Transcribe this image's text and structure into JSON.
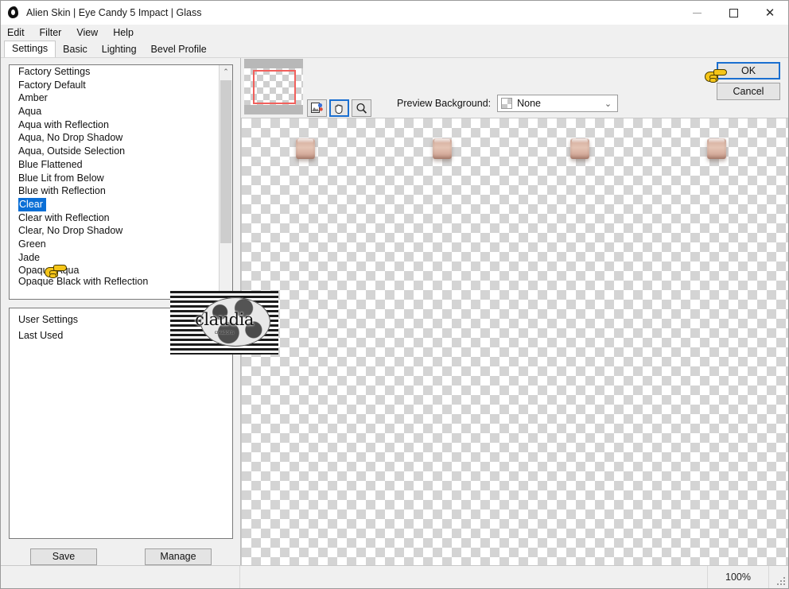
{
  "window": {
    "title": "Alien Skin | Eye Candy 5 Impact | Glass",
    "app_icon": "alien-head-icon",
    "controls": {
      "minimize": "–",
      "maximize": "▢",
      "close": "✕"
    }
  },
  "menubar": {
    "items": [
      "Edit",
      "Filter",
      "View",
      "Help"
    ]
  },
  "tabs": {
    "items": [
      "Settings",
      "Basic",
      "Lighting",
      "Bevel Profile"
    ],
    "active": "Settings"
  },
  "presets": {
    "items": [
      "Factory Settings",
      "Factory Default",
      "Amber",
      "Aqua",
      "Aqua with Reflection",
      "Aqua, No Drop Shadow",
      "Aqua, Outside Selection",
      "Blue Flattened",
      "Blue Lit from Below",
      "Blue with Reflection",
      "Clear",
      "Clear with Reflection",
      "Clear, No Drop Shadow",
      "Green",
      "Jade",
      "Opaque Aqua",
      "Opaque Black with Reflection"
    ],
    "selected": "Clear",
    "scroll_up_arrow": "⌃"
  },
  "user_settings": {
    "items": [
      "User Settings",
      "Last Used"
    ]
  },
  "preset_buttons": {
    "save": "Save",
    "manage": "Manage"
  },
  "toolbar": {
    "tools": [
      {
        "name": "image-tool",
        "glyph": "◧"
      },
      {
        "name": "hand-tool",
        "glyph": "✋",
        "active": true
      },
      {
        "name": "zoom-tool",
        "glyph": "⚲"
      }
    ],
    "preview_background_label": "Preview Background:",
    "preview_background_value": "None",
    "chevron": "⌄"
  },
  "dialog_buttons": {
    "ok": "OK",
    "cancel": "Cancel"
  },
  "statusbar": {
    "zoom": "100%",
    "message": ""
  },
  "watermark": {
    "text": "claudia",
    "subtext": "creations"
  },
  "colors": {
    "accent": "#0b6fd6",
    "focus_border": "#1a6fd0",
    "viewport_rect": "#f1605c",
    "window_bg": "#f0f0f0",
    "cursor": "#f5c518"
  }
}
